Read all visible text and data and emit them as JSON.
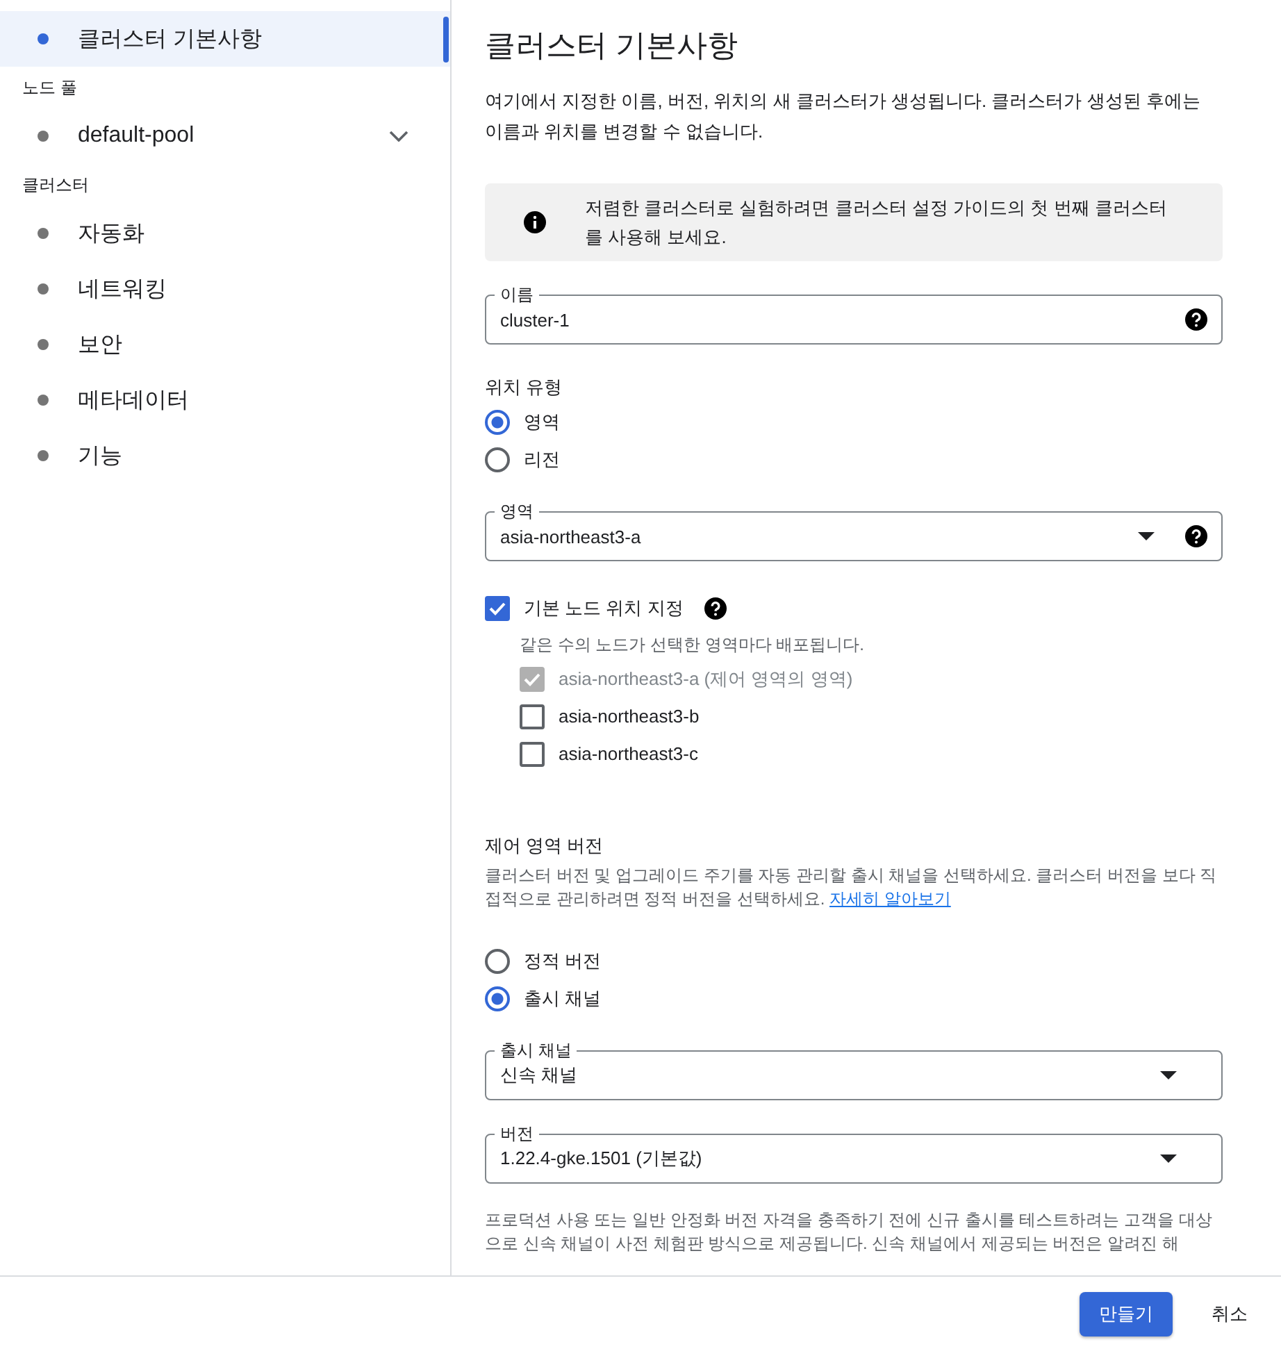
{
  "sidebar": {
    "items": [
      {
        "kind": "item",
        "label": "클러스터 기본사항",
        "selected": true
      },
      {
        "kind": "heading",
        "label": "노드 풀"
      },
      {
        "kind": "item",
        "label": "default-pool",
        "selected": false,
        "expandable": true
      },
      {
        "kind": "heading",
        "label": "클러스터"
      },
      {
        "kind": "item",
        "label": "자동화",
        "selected": false
      },
      {
        "kind": "item",
        "label": "네트워킹",
        "selected": false
      },
      {
        "kind": "item",
        "label": "보안",
        "selected": false
      },
      {
        "kind": "item",
        "label": "메타데이터",
        "selected": false
      },
      {
        "kind": "item",
        "label": "기능",
        "selected": false
      }
    ]
  },
  "main": {
    "title": "클러스터 기본사항",
    "description": "여기에서 지정한 이름, 버전, 위치의 새 클러스터가 생성됩니다. 클러스터가 생성된 후에는 이름과 위치를 변경할 수 없습니다.",
    "info_banner": "저렴한 클러스터로 실험하려면 클러스터 설정 가이드의 첫 번째 클러스터를 사용해 보세요.",
    "fields": [
      {
        "kind": "text",
        "label": "이름",
        "value": "cluster-1",
        "help": true
      },
      {
        "kind": "group",
        "label": "위치 유형",
        "options": [
          {
            "label": "영역",
            "selected": true
          },
          {
            "label": "리전",
            "selected": false
          }
        ]
      },
      {
        "kind": "select",
        "label": "영역",
        "value": "asia-northeast3-a",
        "help": true
      },
      {
        "kind": "checkgroup",
        "label": "기본 노드 위치 지정",
        "checked": true,
        "help": true,
        "hint": "같은 수의 노드가 선택한 영역마다 배포됩니다.",
        "zones": [
          {
            "label": "asia-northeast3-a (제어 영역의 영역)",
            "checked": true,
            "disabled": true
          },
          {
            "label": "asia-northeast3-b",
            "checked": false,
            "disabled": false
          },
          {
            "label": "asia-northeast3-c",
            "checked": false,
            "disabled": false
          }
        ]
      },
      {
        "kind": "section",
        "title": "제어 영역 버전",
        "description": "클러스터 버전 및 업그레이드 주기를 자동 관리할 출시 채널을 선택하세요. 클러스터 버전을 보다 직접적으로 관리하려면 정적 버전을 선택하세요.",
        "link": "자세히 알아보기"
      },
      {
        "kind": "group",
        "options": [
          {
            "label": "정적 버전",
            "selected": false
          },
          {
            "label": "출시 채널",
            "selected": true
          }
        ]
      },
      {
        "kind": "select",
        "label": "출시 채널",
        "value": "신속 채널",
        "help": false
      },
      {
        "kind": "select",
        "label": "버전",
        "value": "1.22.4-gke.1501 (기본값)",
        "help": false
      },
      {
        "kind": "note",
        "text": "프로덕션 사용 또는 일반 안정화 버전 자격을 충족하기 전에 신규 출시를 테스트하려는 고객을 대상으로 신속 채널이 사전 체험판 방식으로 제공됩니다. 신속 채널에서 제공되는 버전은 알려진 해"
      }
    ]
  },
  "footer": {
    "buttons": [
      {
        "kind": "primary",
        "label": "만들기"
      },
      {
        "kind": "text",
        "label": "취소"
      }
    ]
  }
}
